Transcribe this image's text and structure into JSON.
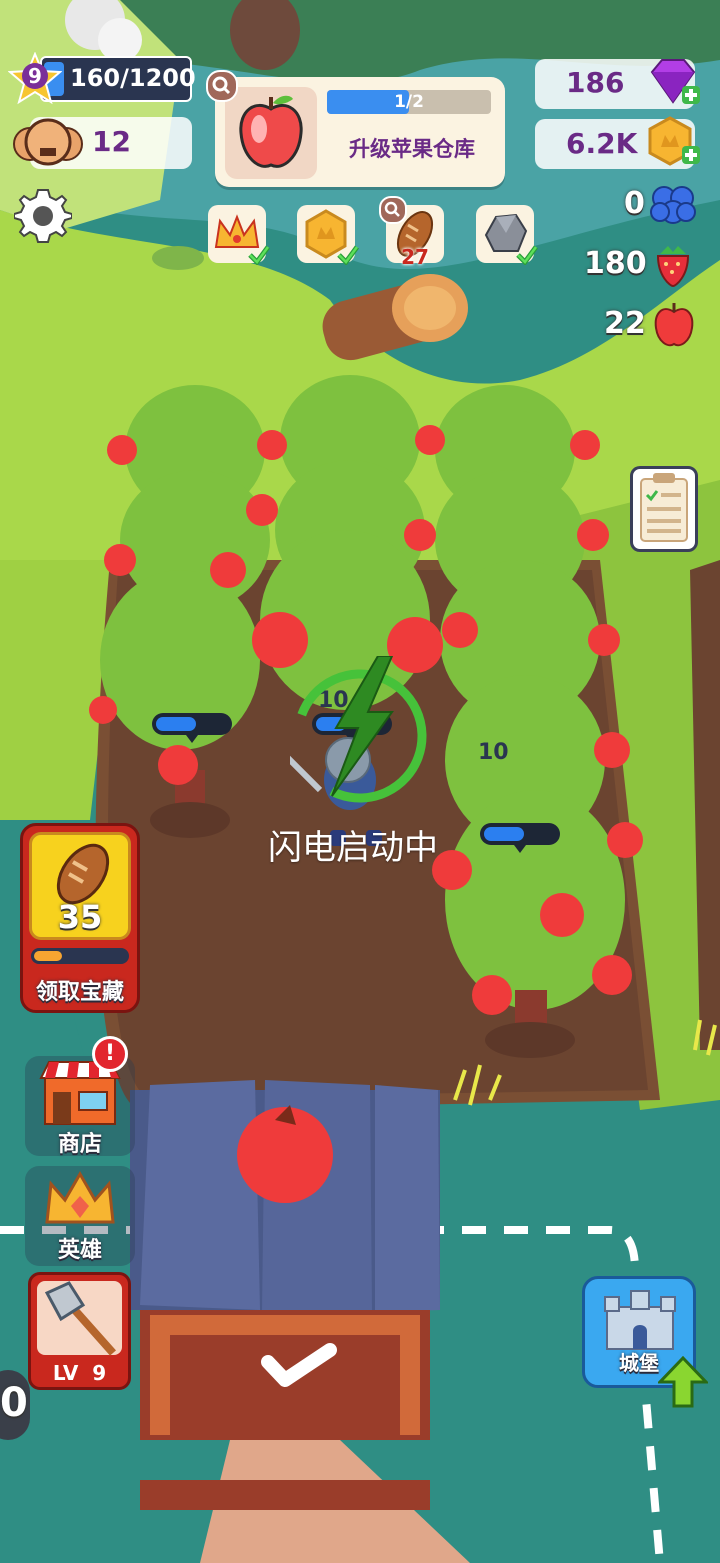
{
  "player": {
    "level": "9",
    "xp_text": "160/1200",
    "xp_fraction": 0.133
  },
  "workers": {
    "count": "12"
  },
  "quest": {
    "progress_text": "1/2",
    "progress_fraction": 0.5,
    "title": "升级苹果仓库"
  },
  "tasks": [
    {
      "icon": "crown-icon",
      "done": true,
      "count": ""
    },
    {
      "icon": "coin-icon",
      "done": true,
      "count": ""
    },
    {
      "icon": "bread-icon",
      "done": false,
      "count": "27"
    },
    {
      "icon": "stone-icon",
      "done": true,
      "count": ""
    }
  ],
  "resources": {
    "gems": "186",
    "coins": "6.2K",
    "berries": "0",
    "strawberries": "180",
    "apples": "22"
  },
  "trees": {
    "labels": [
      "10",
      "10"
    ]
  },
  "status": {
    "lightning_text": "闪电启动中"
  },
  "treasure": {
    "count": "35",
    "label": "领取宝藏",
    "progress_fraction": 0.3
  },
  "shop": {
    "label": "商店",
    "alert": "!"
  },
  "hero": {
    "label": "英雄"
  },
  "weapon": {
    "level_text": "LV  9"
  },
  "castle": {
    "label": "城堡"
  },
  "left_edge_digit": "0",
  "colors": {
    "accent_blue": "#2b7ff0",
    "gem_purple": "#b23ee6",
    "shop_red": "#e2262e",
    "grass": "#a9d84a",
    "soil": "#7a4f34"
  }
}
